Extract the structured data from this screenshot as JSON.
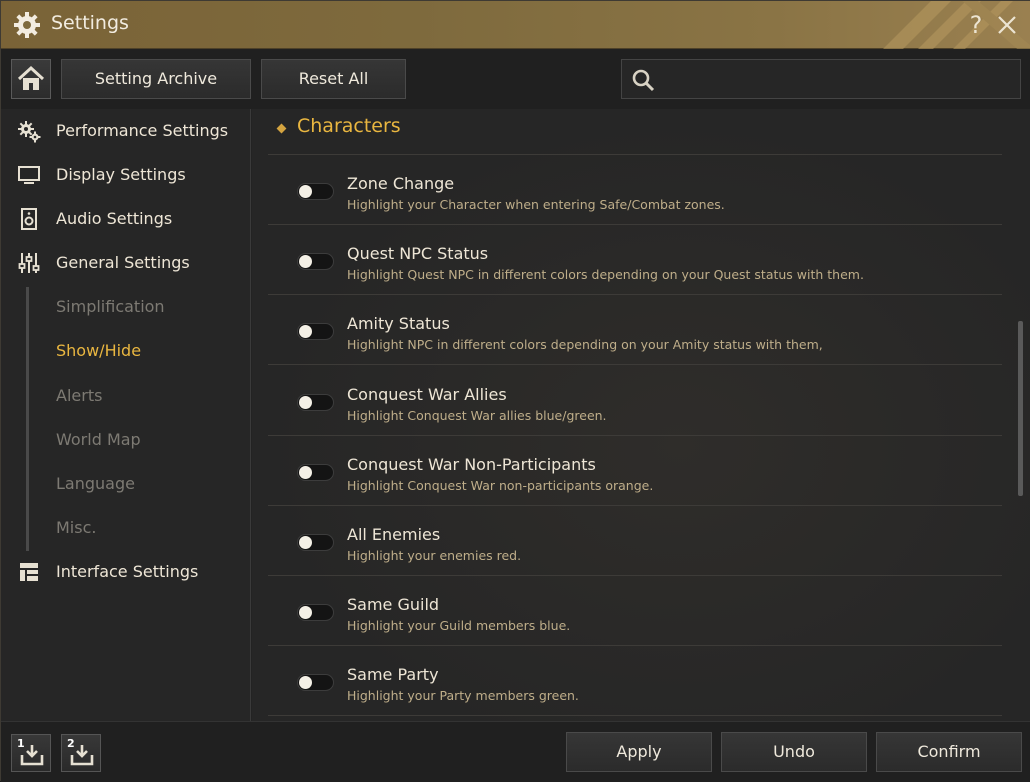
{
  "window": {
    "title": "Settings",
    "help_label": "?",
    "icons": {
      "title": "gear-icon",
      "close": "close-icon"
    }
  },
  "toolbar": {
    "home_icon": "home-icon",
    "setting_archive_label": "Setting Archive",
    "reset_all_label": "Reset All",
    "search": {
      "value": "",
      "placeholder": "",
      "icon": "search-icon"
    }
  },
  "sidebar": {
    "items": [
      {
        "label": "Performance Settings",
        "icon": "gears-icon"
      },
      {
        "label": "Display Settings",
        "icon": "monitor-icon"
      },
      {
        "label": "Audio Settings",
        "icon": "speaker-icon"
      },
      {
        "label": "General Settings",
        "icon": "sliders-icon"
      },
      {
        "label": "Interface Settings",
        "icon": "layout-icon"
      }
    ],
    "general_subitems": [
      {
        "label": "Simplification",
        "active": false
      },
      {
        "label": "Show/Hide",
        "active": true
      },
      {
        "label": "Alerts",
        "active": false
      },
      {
        "label": "World Map",
        "active": false
      },
      {
        "label": "Language",
        "active": false
      },
      {
        "label": "Misc.",
        "active": false
      }
    ]
  },
  "content": {
    "section_title": "Characters",
    "options": [
      {
        "title": "Zone Change",
        "description": "Highlight your Character when entering Safe/Combat zones.",
        "enabled": false
      },
      {
        "title": "Quest NPC Status",
        "description": "Highlight Quest NPC in different colors depending on your Quest status with them.",
        "enabled": false
      },
      {
        "title": "Amity Status",
        "description": "Highlight NPC in different colors depending on your Amity status with them,",
        "enabled": false
      },
      {
        "title": "Conquest War Allies",
        "description": "Highlight Conquest War allies blue/green.",
        "enabled": false
      },
      {
        "title": "Conquest War Non-Participants",
        "description": "Highlight Conquest War non-participants orange.",
        "enabled": false
      },
      {
        "title": "All Enemies",
        "description": "Highlight your enemies red.",
        "enabled": false
      },
      {
        "title": "Same Guild",
        "description": "Highlight your Guild members blue.",
        "enabled": false
      },
      {
        "title": "Same Party",
        "description": "Highlight your Party members green.",
        "enabled": false
      }
    ]
  },
  "footer": {
    "save_slots": [
      {
        "number": "1",
        "icon": "download-icon"
      },
      {
        "number": "2",
        "icon": "download-icon"
      }
    ],
    "apply_label": "Apply",
    "undo_label": "Undo",
    "confirm_label": "Confirm"
  },
  "colors": {
    "accent_gold": "#e9b640",
    "titlebar": "#7e6a3d",
    "description_text": "#bfae8a",
    "inactive_subitem": "#7d7a73"
  }
}
